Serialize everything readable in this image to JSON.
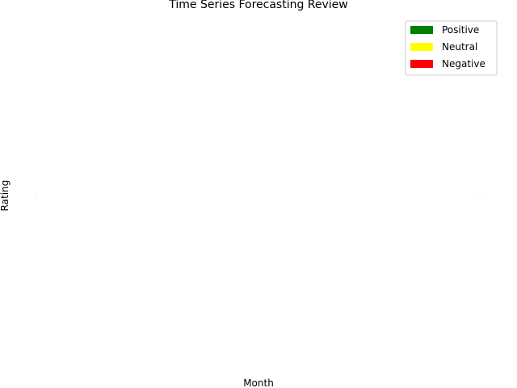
{
  "chart_data": {
    "type": "bar",
    "title": "Time Series Forecasting Review",
    "xlabel": "Month",
    "ylabel": "Rating",
    "grid": false,
    "legend_position": "top-right",
    "categories": [],
    "series": [
      {
        "name": "Positive",
        "color": "#008000",
        "values": []
      },
      {
        "name": "Neutral",
        "color": "#ffff00",
        "values": []
      },
      {
        "name": "Negative",
        "color": "#ff0000",
        "values": []
      }
    ]
  }
}
